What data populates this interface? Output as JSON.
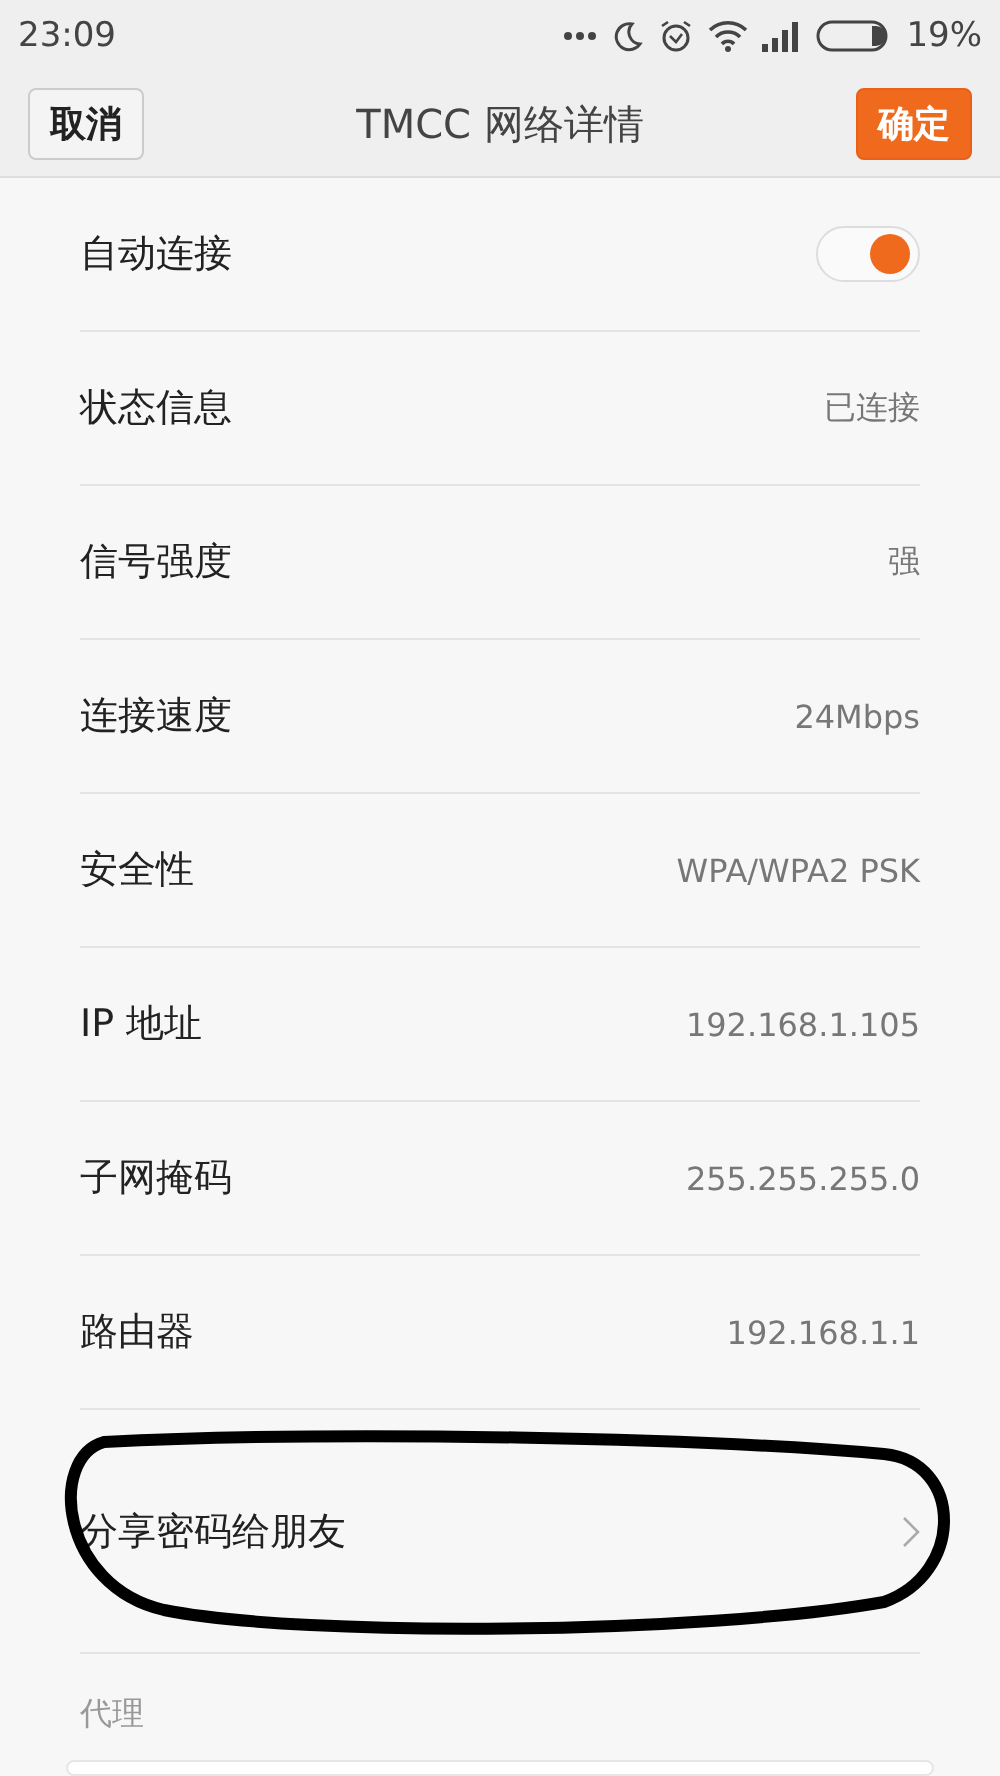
{
  "status_bar": {
    "time": "23:09",
    "battery": "19%"
  },
  "header": {
    "cancel": "取消",
    "title": "TMCC 网络详情",
    "confirm": "确定"
  },
  "rows": [
    {
      "kind": "toggle",
      "label": "自动连接",
      "on": true
    },
    {
      "kind": "value",
      "label": "状态信息",
      "value": "已连接"
    },
    {
      "kind": "value",
      "label": "信号强度",
      "value": "强"
    },
    {
      "kind": "value",
      "label": "连接速度",
      "value": "24Mbps"
    },
    {
      "kind": "value",
      "label": "安全性",
      "value": "WPA/WPA2 PSK"
    },
    {
      "kind": "value",
      "label": "IP 地址",
      "value": "192.168.1.105"
    },
    {
      "kind": "value",
      "label": "子网掩码",
      "value": "255.255.255.0"
    },
    {
      "kind": "value",
      "label": "路由器",
      "value": "192.168.1.1"
    },
    {
      "kind": "link",
      "label": "分享密码给朋友",
      "circled": true
    }
  ],
  "proxy": {
    "label": "代理"
  }
}
